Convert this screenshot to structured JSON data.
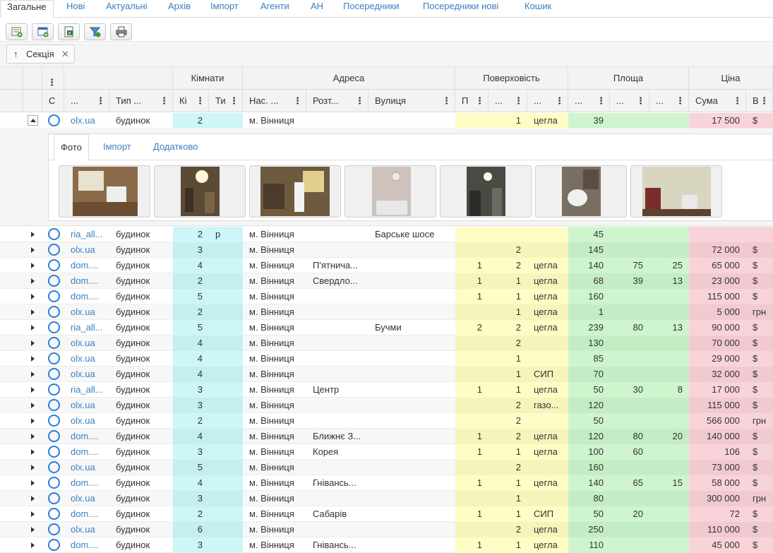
{
  "tabs": [
    "Загальне",
    "Нові",
    "Актуальні",
    "Архів",
    "Імпорт",
    "Агенти",
    "АН",
    "Посередники",
    "Посередники нові",
    "Кошик"
  ],
  "active_tab": "Загальне",
  "toolbar": {
    "icons": [
      "add-record-icon",
      "add-window-icon",
      "export-excel-icon",
      "filter-icon",
      "print-icon"
    ]
  },
  "group": {
    "arrow": "↑",
    "label": "Секція",
    "close": "✕"
  },
  "header": {
    "groups": {
      "rooms": "Кімнати",
      "address": "Адреса",
      "floors": "Поверховість",
      "area": "Площа",
      "price": "Ціна"
    },
    "columns": {
      "col_c": "С",
      "source": "...",
      "type": "Тип ...",
      "rooms_count": "Кі",
      "rooms_type": "Ти",
      "settlement": "Нас. ...",
      "district": "Розт...",
      "street": "Вулиця",
      "floor": "П",
      "floors": "...",
      "material": "...",
      "area_total": "...",
      "area_living": "...",
      "area_kitchen": "...",
      "price_sum": "Сума",
      "currency": "В"
    }
  },
  "expanded_row": {
    "source": "olx.ua",
    "type": "будинок",
    "rooms": "2",
    "rooms_type": "",
    "settlement": "м. Вінниця",
    "district": "",
    "street": "",
    "floor": "",
    "floors": "1",
    "material": "цегла",
    "area_total": "39",
    "area_living": "",
    "area_kitchen": "",
    "price": "17 500",
    "currency": "$"
  },
  "detail": {
    "tabs": [
      "Фото",
      "Імпорт",
      "Додатково"
    ],
    "photo_count": 7
  },
  "rows": [
    {
      "source": "ria_all...",
      "type": "будинок",
      "rooms": "2",
      "rooms_type": "р",
      "settlement": "м. Вінниця",
      "district": "",
      "street": "Барське шосе",
      "floor": "",
      "floors": "",
      "material": "",
      "area_total": "45",
      "area_living": "",
      "area_kitchen": "",
      "price": "",
      "currency": ""
    },
    {
      "source": "olx.ua",
      "type": "будинок",
      "rooms": "3",
      "rooms_type": "",
      "settlement": "м. Вінниця",
      "district": "",
      "street": "",
      "floor": "",
      "floors": "2",
      "material": "",
      "area_total": "145",
      "area_living": "",
      "area_kitchen": "",
      "price": "72 000",
      "currency": "$"
    },
    {
      "source": "dom....",
      "type": "будинок",
      "rooms": "4",
      "rooms_type": "",
      "settlement": "м. Вінниця",
      "district": "П'ятнича...",
      "street": "",
      "floor": "1",
      "floors": "2",
      "material": "цегла",
      "area_total": "140",
      "area_living": "75",
      "area_kitchen": "25",
      "price": "65 000",
      "currency": "$"
    },
    {
      "source": "dom....",
      "type": "будинок",
      "rooms": "2",
      "rooms_type": "",
      "settlement": "м. Вінниця",
      "district": "Свердло...",
      "street": "",
      "floor": "1",
      "floors": "1",
      "material": "цегла",
      "area_total": "68",
      "area_living": "39",
      "area_kitchen": "13",
      "price": "23 000",
      "currency": "$"
    },
    {
      "source": "dom....",
      "type": "будинок",
      "rooms": "5",
      "rooms_type": "",
      "settlement": "м. Вінниця",
      "district": "",
      "street": "",
      "floor": "1",
      "floors": "1",
      "material": "цегла",
      "area_total": "160",
      "area_living": "",
      "area_kitchen": "",
      "price": "115 000",
      "currency": "$"
    },
    {
      "source": "olx.ua",
      "type": "будинок",
      "rooms": "2",
      "rooms_type": "",
      "settlement": "м. Вінниця",
      "district": "",
      "street": "",
      "floor": "",
      "floors": "1",
      "material": "цегла",
      "area_total": "1",
      "area_living": "",
      "area_kitchen": "",
      "price": "5 000",
      "currency": "грн"
    },
    {
      "source": "ria_all...",
      "type": "будинок",
      "rooms": "5",
      "rooms_type": "",
      "settlement": "м. Вінниця",
      "district": "",
      "street": "Бучми",
      "floor": "2",
      "floors": "2",
      "material": "цегла",
      "area_total": "239",
      "area_living": "80",
      "area_kitchen": "13",
      "price": "90 000",
      "currency": "$"
    },
    {
      "source": "olx.ua",
      "type": "будинок",
      "rooms": "4",
      "rooms_type": "",
      "settlement": "м. Вінниця",
      "district": "",
      "street": "",
      "floor": "",
      "floors": "2",
      "material": "",
      "area_total": "130",
      "area_living": "",
      "area_kitchen": "",
      "price": "70 000",
      "currency": "$"
    },
    {
      "source": "olx.ua",
      "type": "будинок",
      "rooms": "4",
      "rooms_type": "",
      "settlement": "м. Вінниця",
      "district": "",
      "street": "",
      "floor": "",
      "floors": "1",
      "material": "",
      "area_total": "85",
      "area_living": "",
      "area_kitchen": "",
      "price": "29 000",
      "currency": "$"
    },
    {
      "source": "olx.ua",
      "type": "будинок",
      "rooms": "4",
      "rooms_type": "",
      "settlement": "м. Вінниця",
      "district": "",
      "street": "",
      "floor": "",
      "floors": "1",
      "material": "СИП",
      "area_total": "70",
      "area_living": "",
      "area_kitchen": "",
      "price": "32 000",
      "currency": "$"
    },
    {
      "source": "ria_all...",
      "type": "будинок",
      "rooms": "3",
      "rooms_type": "",
      "settlement": "м. Вінниця",
      "district": "Центр",
      "street": "",
      "floor": "1",
      "floors": "1",
      "material": "цегла",
      "area_total": "50",
      "area_living": "30",
      "area_kitchen": "8",
      "price": "17 000",
      "currency": "$"
    },
    {
      "source": "olx.ua",
      "type": "будинок",
      "rooms": "3",
      "rooms_type": "",
      "settlement": "м. Вінниця",
      "district": "",
      "street": "",
      "floor": "",
      "floors": "2",
      "material": "газо...",
      "area_total": "120",
      "area_living": "",
      "area_kitchen": "",
      "price": "115 000",
      "currency": "$"
    },
    {
      "source": "olx.ua",
      "type": "будинок",
      "rooms": "2",
      "rooms_type": "",
      "settlement": "м. Вінниця",
      "district": "",
      "street": "",
      "floor": "",
      "floors": "2",
      "material": "",
      "area_total": "50",
      "area_living": "",
      "area_kitchen": "",
      "price": "566 000",
      "currency": "грн"
    },
    {
      "source": "dom....",
      "type": "будинок",
      "rooms": "4",
      "rooms_type": "",
      "settlement": "м. Вінниця",
      "district": "Ближнє З...",
      "street": "",
      "floor": "1",
      "floors": "2",
      "material": "цегла",
      "area_total": "120",
      "area_living": "80",
      "area_kitchen": "20",
      "price": "140 000",
      "currency": "$"
    },
    {
      "source": "dom....",
      "type": "будинок",
      "rooms": "3",
      "rooms_type": "",
      "settlement": "м. Вінниця",
      "district": "Корея",
      "street": "",
      "floor": "1",
      "floors": "1",
      "material": "цегла",
      "area_total": "100",
      "area_living": "60",
      "area_kitchen": "",
      "price": "106",
      "currency": "$"
    },
    {
      "source": "olx.ua",
      "type": "будинок",
      "rooms": "5",
      "rooms_type": "",
      "settlement": "м. Вінниця",
      "district": "",
      "street": "",
      "floor": "",
      "floors": "2",
      "material": "",
      "area_total": "160",
      "area_living": "",
      "area_kitchen": "",
      "price": "73 000",
      "currency": "$"
    },
    {
      "source": "dom....",
      "type": "будинок",
      "rooms": "4",
      "rooms_type": "",
      "settlement": "м. Вінниця",
      "district": "Гнівансь...",
      "street": "",
      "floor": "1",
      "floors": "1",
      "material": "цегла",
      "area_total": "140",
      "area_living": "65",
      "area_kitchen": "15",
      "price": "58 000",
      "currency": "$"
    },
    {
      "source": "olx.ua",
      "type": "будинок",
      "rooms": "3",
      "rooms_type": "",
      "settlement": "м. Вінниця",
      "district": "",
      "street": "",
      "floor": "",
      "floors": "1",
      "material": "",
      "area_total": "80",
      "area_living": "",
      "area_kitchen": "",
      "price": "300 000",
      "currency": "грн"
    },
    {
      "source": "dom....",
      "type": "будинок",
      "rooms": "2",
      "rooms_type": "",
      "settlement": "м. Вінниця",
      "district": "Сабарів",
      "street": "",
      "floor": "1",
      "floors": "1",
      "material": "СИП",
      "area_total": "50",
      "area_living": "20",
      "area_kitchen": "",
      "price": "72",
      "currency": "$"
    },
    {
      "source": "olx.ua",
      "type": "будинок",
      "rooms": "6",
      "rooms_type": "",
      "settlement": "м. Вінниця",
      "district": "",
      "street": "",
      "floor": "",
      "floors": "2",
      "material": "цегла",
      "area_total": "250",
      "area_living": "",
      "area_kitchen": "",
      "price": "110 000",
      "currency": "$"
    },
    {
      "source": "dom....",
      "type": "будинок",
      "rooms": "3",
      "rooms_type": "",
      "settlement": "м. Вінниця",
      "district": "Гнівансь...",
      "street": "",
      "floor": "1",
      "floors": "1",
      "material": "цегла",
      "area_total": "110",
      "area_living": "",
      "area_kitchen": "",
      "price": "45 000",
      "currency": "$"
    }
  ]
}
